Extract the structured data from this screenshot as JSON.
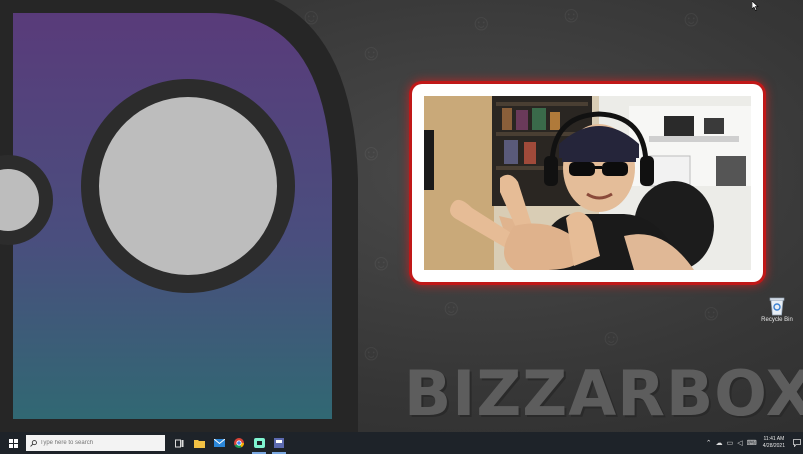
{
  "desktop": {
    "wallpaper_text": "BIZZARBOX",
    "colors": {
      "frame_border": "#c01818",
      "ghost_gradient_top": "#5a3a7a",
      "ghost_gradient_bottom": "#2f6a72"
    }
  },
  "webcam": {
    "name": "webcam-overlay"
  },
  "recycle_bin": {
    "label": "Recycle Bin",
    "icon": "recycle-bin-icon"
  },
  "taskbar": {
    "start_icon": "windows-logo-icon",
    "search": {
      "placeholder": "Type here to search",
      "icon": "search-icon"
    },
    "apps": [
      {
        "name": "task-view",
        "icon": "task-view-icon"
      },
      {
        "name": "file-explorer",
        "icon": "folder-icon"
      },
      {
        "name": "mail",
        "icon": "mail-icon"
      },
      {
        "name": "chrome",
        "icon": "chrome-icon"
      },
      {
        "name": "streamlabs",
        "icon": "streamlabs-icon"
      },
      {
        "name": "app",
        "icon": "app-icon"
      }
    ],
    "clock": {
      "time": "11:41 AM",
      "date": "4/28/2021"
    }
  }
}
